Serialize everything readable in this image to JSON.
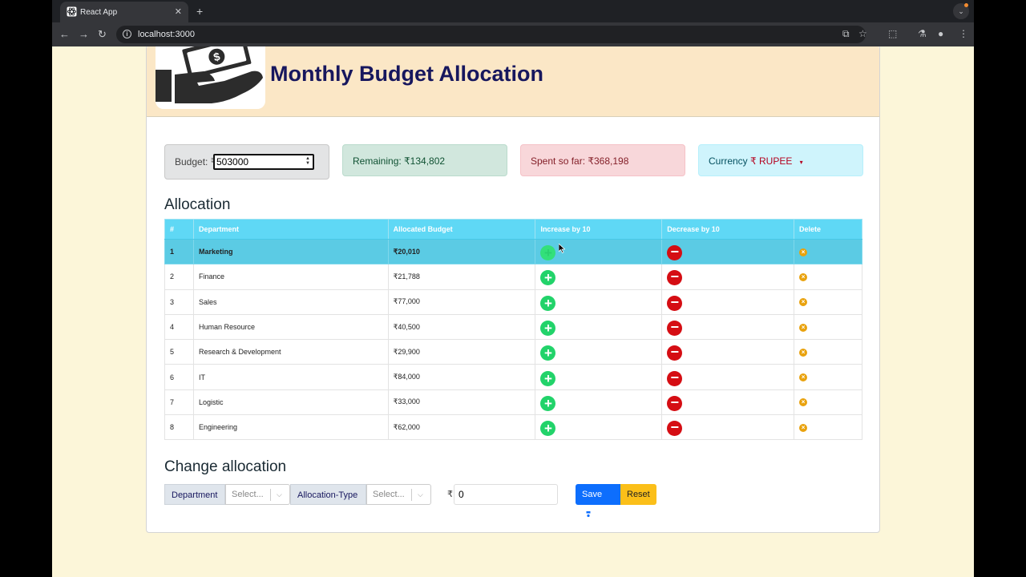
{
  "browser": {
    "tab_title": "React App",
    "tab_close": "✕",
    "new_tab": "+",
    "url": "localhost:3000"
  },
  "page": {
    "title": "Monthly Budget Allocation"
  },
  "stats": {
    "budget_label": "Budget: ₹",
    "budget_value": "503000",
    "remaining": "Remaining: ₹134,802",
    "spent": "Spent so far: ₹368,198",
    "currency_label": "Currency ",
    "currency_value": "₹ RUPEE"
  },
  "allocation": {
    "title": "Allocation",
    "columns": [
      "#",
      "Department",
      "Allocated Budget",
      "Increase by 10",
      "Decrease by 10",
      "Delete"
    ],
    "rows": [
      {
        "num": "1",
        "department": "Marketing",
        "budget": "₹20,010"
      },
      {
        "num": "2",
        "department": "Finance",
        "budget": "₹21,788"
      },
      {
        "num": "3",
        "department": "Sales",
        "budget": "₹77,000"
      },
      {
        "num": "4",
        "department": "Human Resource",
        "budget": "₹40,500"
      },
      {
        "num": "5",
        "department": "Research & Development",
        "budget": "₹29,900"
      },
      {
        "num": "6",
        "department": "IT",
        "budget": "₹84,000"
      },
      {
        "num": "7",
        "department": "Logistic",
        "budget": "₹33,000"
      },
      {
        "num": "8",
        "department": "Engineering",
        "budget": "₹62,000"
      }
    ]
  },
  "change": {
    "title": "Change allocation",
    "department_label": "Department",
    "department_placeholder": "Select...",
    "type_label": "Allocation-Type",
    "type_placeholder": "Select...",
    "currency_symbol": "₹",
    "amount": "0",
    "save_label": "Save",
    "reset_label": "Reset"
  },
  "colors": {
    "header_bg": "#fbe7c6",
    "title": "#17175e",
    "table_head": "#5fd8f5",
    "increase": "#22d36a",
    "decrease": "#d50d13",
    "delete": "#e9a20d"
  },
  "icons": [
    "react-favicon",
    "back-arrow-icon",
    "forward-arrow-icon",
    "reload-icon",
    "site-info-icon",
    "install-app-icon",
    "bookmark-star-icon",
    "extensions-icon",
    "chrome-labs-icon",
    "profile-icon",
    "menu-icon",
    "money-hand-icon",
    "plus-circle-icon",
    "minus-circle-icon",
    "x-circle-icon",
    "floppy-disk-icon",
    "chevron-down-icon"
  ]
}
